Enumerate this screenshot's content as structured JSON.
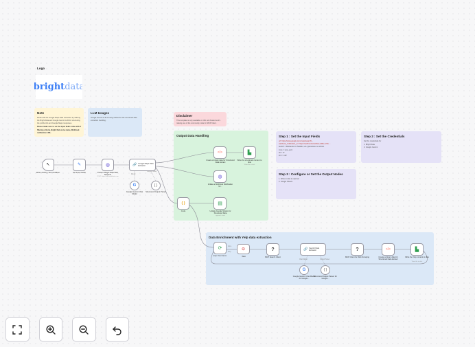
{
  "notes": {
    "logo": {
      "title": "Logo",
      "logo_text": "bright data",
      "logo_bright": "bright",
      "logo_data": "data"
    },
    "note": {
      "title": "Note",
      "lines": [
        "Deals with the Google Maps data extraction by utilizing",
        "the Bright Data and Google Gemini LLM for structuring",
        "the profile info and Google Maps responses.",
        "Please make sure to set the input fields node with the",
        "filtering criteria, Bright Data zone name, Webhook",
        "notification URL."
      ]
    },
    "llm": {
      "title": "LLM Usages",
      "lines": [
        "Google Gemini LLM is being utilized for the structured data",
        "extraction handling."
      ]
    },
    "disclaimer": {
      "title": "Disclaimer",
      "lines": [
        "This template is only available on n8n self-hosted as it's",
        "making use of the community node for MCP Client."
      ]
    },
    "output": {
      "title": "Output Data Handling"
    },
    "step1": {
      "title": "Step 1 : Set the Input Fields",
      "lines": [
        "url: https://www.google.com/maps/search/...",
        "webhook_notification_url: https://webhook.site/c9ea-4d8e-a7a6-...",
        "search = Restaurant in Seattle, set q parameter as shown",
        "zone = serp_api1",
        "lat = 47",
        "lon = -122"
      ]
    },
    "step2": {
      "title": "Step 2 : Set the Credentials",
      "lines": [
        "Set the credentials for",
        "1. Bright Data",
        "2. Google Gemini"
      ]
    },
    "step3": {
      "title": "Step 3 : Configure or Set the Output Nodes",
      "lines": [
        "1. Write to disk is optional",
        "2. Google Sheets"
      ]
    },
    "enrich": {
      "title": "Data Enrichment with Yelp data extraction"
    }
  },
  "nodes": {
    "trigger": {
      "label": "When clicking 'Test workflow'",
      "icon": "pointer-icon"
    },
    "set_fields": {
      "label": "Set Input Fields",
      "icon": "pencil-icon"
    },
    "perform_request": {
      "label": "Perform Bright Data Web Request",
      "sub": "POST: https://api.brightdata.com",
      "icon": "globe-icon"
    },
    "gmaps_extractor": {
      "label": "Google Maps Data Extractor",
      "icon": "link-icon"
    },
    "gemini_chat": {
      "label": "Google Gemini Chat Model",
      "icon": "google-icon"
    },
    "structured_parser": {
      "label": "Structured Output Parser",
      "icon": "braces-icon"
    },
    "binary_create": {
      "label": "Create a binary data for Structured Data Extract",
      "icon": "code-icon"
    },
    "write_disk": {
      "label": "Write the structured content to disk",
      "sub": "Write file to disk",
      "icon": "file-icon"
    },
    "webhook_notify": {
      "label": "Initiate a Webhook Notification for...",
      "sub": "POST: https://webhook...",
      "icon": "globe-icon"
    },
    "code": {
      "label": "Code",
      "icon": "code-braces-icon"
    },
    "update_sheets": {
      "label": "Update Google Sheets for Structured Data",
      "sub": "append: sheet",
      "icon": "sheets-icon"
    },
    "loop": {
      "label": "Loop Over Items",
      "icon": "loop-icon"
    },
    "wait": {
      "label": "Wait",
      "icon": "wait-icon"
    },
    "mcp_search": {
      "label": "MCP Search Client",
      "icon": "question-icon"
    },
    "search_extractor": {
      "label": "Search Data Extractor",
      "icon": "link-icon"
    },
    "gemini_chat2": {
      "label": "Google Gemini Chat Model for Google...",
      "icon": "google-icon"
    },
    "structured_parser2": {
      "label": "Structured Output Parser for Google...",
      "icon": "braces-icon"
    },
    "mcp_scrape": {
      "label": "MCP Client for Web Scraping",
      "icon": "question-icon"
    },
    "binary_create2": {
      "label": "Create a binary data for Structured Data Extract",
      "icon": "code-icon"
    },
    "write_yelp": {
      "label": "Write the Yelp content to disk",
      "sub": "Write file to disk",
      "icon": "file-icon"
    }
  },
  "edge_labels": {
    "model": "Model",
    "output_parser": "Output Parser",
    "chat_model": "Chat Model",
    "done": "done",
    "loop": "loop"
  },
  "toolbar": {
    "fit": {
      "icon": "fit-view-icon"
    },
    "zoom_in": {
      "icon": "zoom-in-icon"
    },
    "zoom_out": {
      "icon": "zoom-out-icon"
    },
    "reset": {
      "icon": "undo-icon"
    }
  },
  "colors": {
    "sticky_yellow": "#fff5d6",
    "sticky_blue": "#dbe8f7",
    "sticky_pink": "#fbd8dc",
    "sticky_green": "#d8f3dd",
    "sticky_purple": "#e5e2f7",
    "accent": "#ff6d5a",
    "edge": "#8b8b95"
  }
}
